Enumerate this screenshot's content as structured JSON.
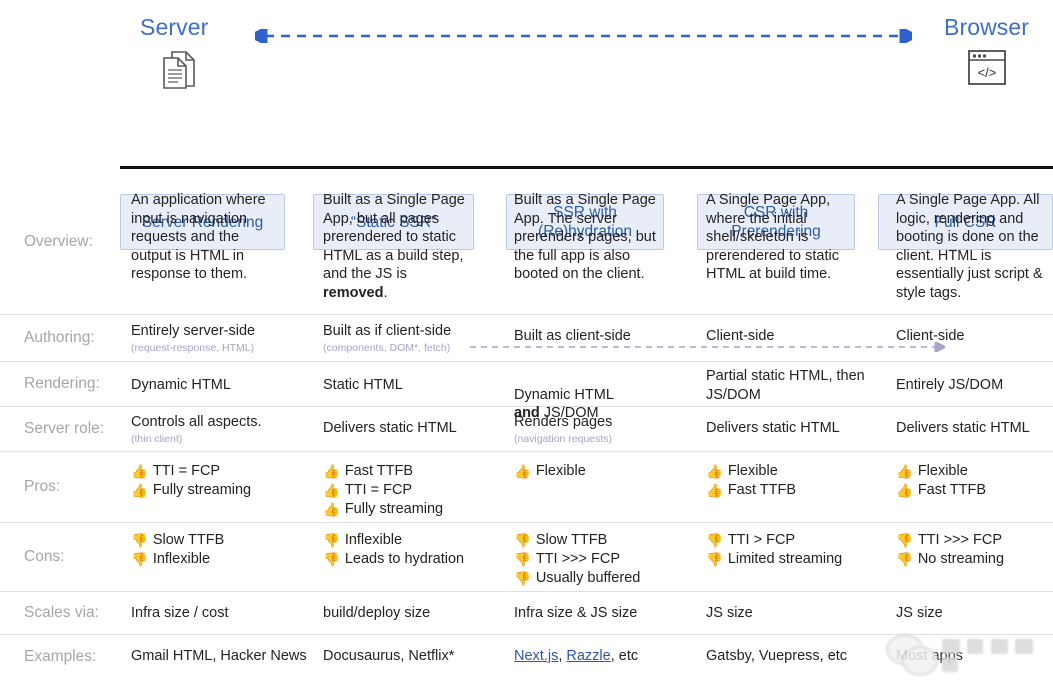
{
  "header": {
    "left_label": "Server",
    "right_label": "Browser",
    "left_icon": "documents-icon",
    "right_icon": "browser-code-icon",
    "axis_arrow": "double-headed-dashed-arrow",
    "accent_color": "#3c6fd0",
    "chip_bg": "#e9edf7",
    "chip_border": "#b9cbe8",
    "chip_text": "#2d5ca6"
  },
  "columns": [
    {
      "label": "Server Rendering"
    },
    {
      "label": "“Static SSR”"
    },
    {
      "label": "SSR with\n(Re)hydration"
    },
    {
      "label": "CSR with\nPrerendering"
    },
    {
      "label": "Full CSR"
    }
  ],
  "rows": [
    {
      "label": "Overview:",
      "cells": [
        {
          "text": "An application where input is navigation requests and the output is HTML in response to them."
        },
        {
          "text": "Built as a Single Page App, but all pages prerendered to static HTML as a build step, and the JS is ",
          "bold": "removed",
          "after": "."
        },
        {
          "text": "Built as a Single Page App. The server prerenders pages, but the full app is also booted on the client."
        },
        {
          "text": "A Single Page App, where the initial shell/skeleton is prerendered to static HTML at build time."
        },
        {
          "text": "A Single Page App. All logic, rendering and booting is done on the client. HTML is essentially just script & style tags."
        }
      ]
    },
    {
      "label": "Authoring:",
      "cells": [
        {
          "text": "Entirely server-side",
          "sub": "(request-response, HTML)"
        },
        {
          "text": "Built as if client-side",
          "sub": "(components, DOM*, fetch)"
        },
        {
          "text": "Built as client-side"
        },
        {
          "text": "Client-side"
        },
        {
          "text": "Client-side"
        }
      ],
      "arrow": "dashed-right-arrow",
      "arrow_color": "#a9a3c9"
    },
    {
      "label": "Rendering:",
      "cells": [
        {
          "text": "Dynamic HTML"
        },
        {
          "text": "Static HTML"
        },
        {
          "text": "Dynamic HTML\n",
          "bold": "and",
          "after": " JS/DOM"
        },
        {
          "text": "Partial static HTML, then JS/DOM"
        },
        {
          "text": "Entirely JS/DOM"
        }
      ]
    },
    {
      "label": "Server role:",
      "cells": [
        {
          "text": "Controls all aspects.",
          "sub": "(thin client)"
        },
        {
          "text": "Delivers static HTML"
        },
        {
          "text": "Renders pages",
          "sub": "(navigation requests)"
        },
        {
          "text": "Delivers static HTML"
        },
        {
          "text": "Delivers static HTML"
        }
      ]
    },
    {
      "label": "Pros:",
      "icon": "thumbs-up-icon",
      "bullet": "👍",
      "cells": [
        {
          "items": [
            "TTI = FCP",
            "Fully streaming"
          ]
        },
        {
          "items": [
            "Fast TTFB",
            "TTI = FCP",
            "Fully streaming"
          ]
        },
        {
          "items": [
            "Flexible"
          ]
        },
        {
          "items": [
            "Flexible",
            "Fast TTFB"
          ]
        },
        {
          "items": [
            "Flexible",
            "Fast TTFB"
          ]
        }
      ]
    },
    {
      "label": "Cons:",
      "icon": "thumbs-down-icon",
      "bullet": "👎",
      "cells": [
        {
          "items": [
            "Slow TTFB",
            "Inflexible"
          ]
        },
        {
          "items": [
            "Inflexible",
            "Leads to hydration"
          ]
        },
        {
          "items": [
            "Slow TTFB",
            "TTI >>> FCP",
            "Usually buffered"
          ]
        },
        {
          "items": [
            "TTI > FCP",
            "Limited streaming"
          ]
        },
        {
          "items": [
            "TTI >>> FCP",
            "No streaming"
          ]
        }
      ]
    },
    {
      "label": "Scales via:",
      "cells": [
        {
          "text": "Infra size / cost"
        },
        {
          "text": "build/deploy size"
        },
        {
          "text": "Infra size & JS size"
        },
        {
          "text": "JS size"
        },
        {
          "text": "JS size"
        }
      ]
    },
    {
      "label": "Examples:",
      "cells": [
        {
          "text": "Gmail HTML, Hacker News"
        },
        {
          "text": "Docusaurus, Netflix*"
        },
        {
          "links": [
            "Next.js",
            "Razzle"
          ],
          "after": ", etc"
        },
        {
          "text": "Gatsby, Vuepress, etc"
        },
        {
          "text": "Most apps"
        }
      ]
    }
  ],
  "watermark": {
    "name": "wechat-watermark",
    "visible": true
  }
}
